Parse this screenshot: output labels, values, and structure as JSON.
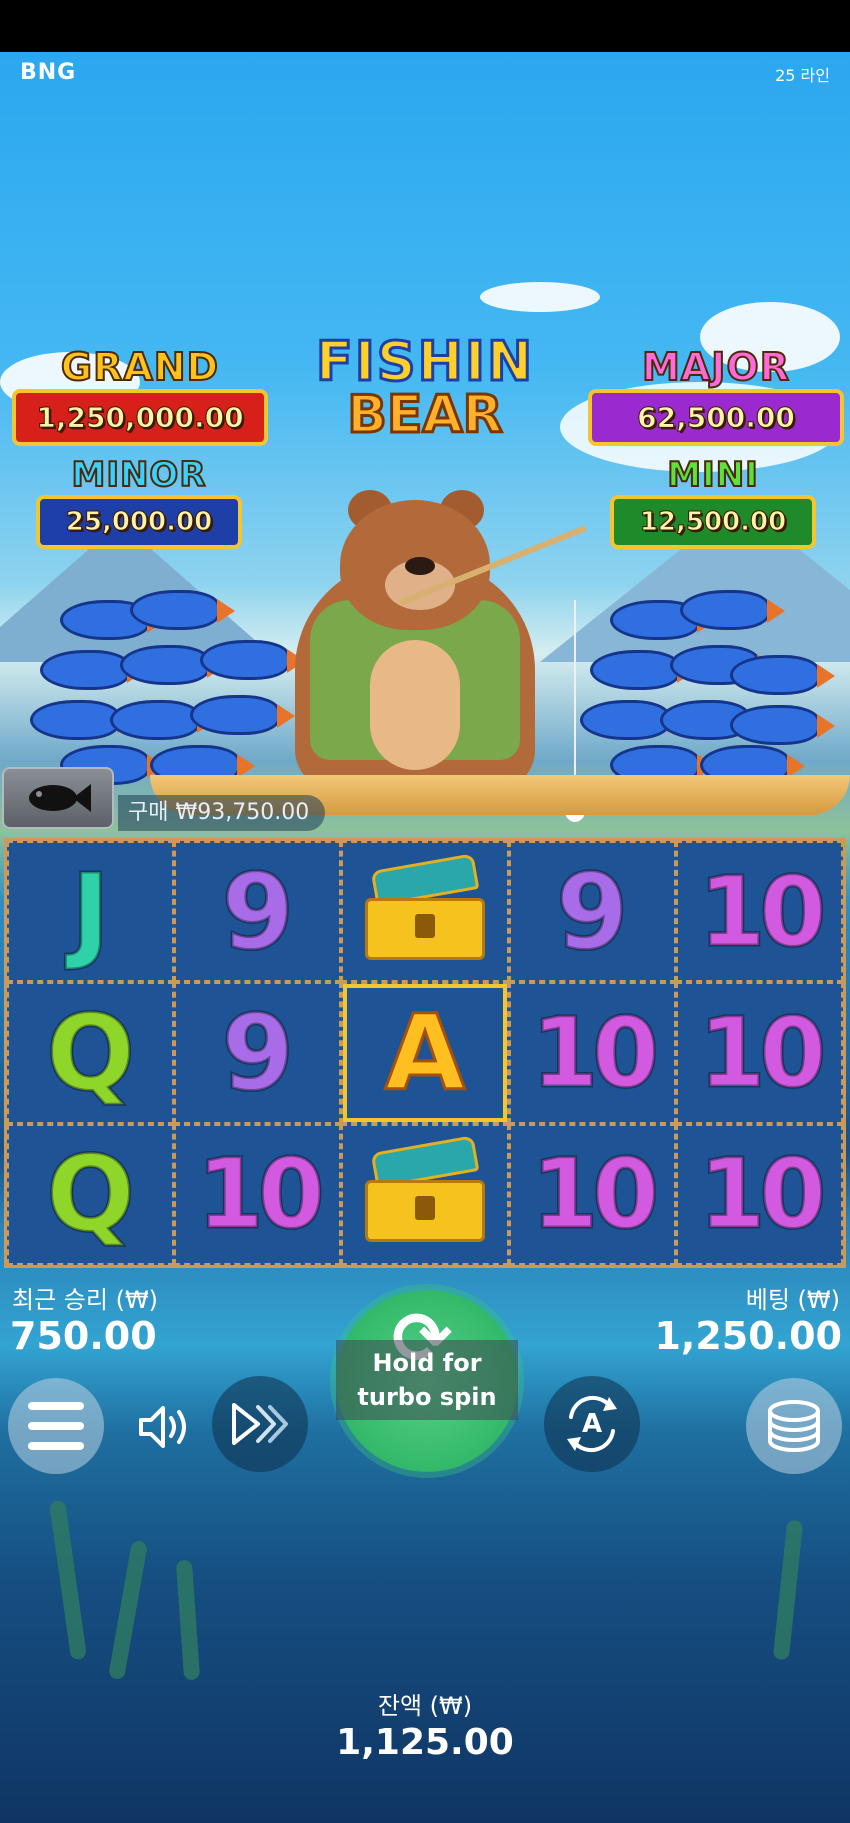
{
  "header": {
    "brand": "BNG",
    "lines": "25 라인"
  },
  "jackpots": {
    "grand": {
      "title": "GRAND",
      "value": "1,250,000.00"
    },
    "major": {
      "title": "MAJOR",
      "value": "62,500.00"
    },
    "minor": {
      "title": "MINOR",
      "value": "25,000.00"
    },
    "mini": {
      "title": "MINI",
      "value": "12,500.00"
    }
  },
  "logo": {
    "line1": "FISHIN",
    "line2": "BEAR"
  },
  "buy_feature": {
    "label": "구매 ₩93,750.00",
    "icon": "fish-icon"
  },
  "reels": [
    [
      {
        "sym": "J",
        "cls": "j"
      },
      {
        "sym": "9",
        "cls": "n9"
      },
      {
        "sym": "chest",
        "cls": "chest"
      },
      {
        "sym": "9",
        "cls": "n9"
      },
      {
        "sym": "10",
        "cls": "n10"
      }
    ],
    [
      {
        "sym": "Q",
        "cls": "q"
      },
      {
        "sym": "9",
        "cls": "n9"
      },
      {
        "sym": "A",
        "cls": "a",
        "highlight": true
      },
      {
        "sym": "10",
        "cls": "n10"
      },
      {
        "sym": "10",
        "cls": "n10"
      }
    ],
    [
      {
        "sym": "Q",
        "cls": "q"
      },
      {
        "sym": "10",
        "cls": "n10"
      },
      {
        "sym": "chest",
        "cls": "chest"
      },
      {
        "sym": "10",
        "cls": "n10"
      },
      {
        "sym": "10",
        "cls": "n10"
      }
    ]
  ],
  "last_win": {
    "label": "최근 승리 (₩)",
    "value": "750.00"
  },
  "bet": {
    "label": "베팅 (₩)",
    "value": "1,250.00"
  },
  "spin": {
    "label": "Hold for turbo spin"
  },
  "auto": {
    "label": "A"
  },
  "balance": {
    "label": "잔액 (₩)",
    "value": "1,125.00"
  },
  "colors": {
    "spin_green": "#33b86a",
    "grand_red": "#d8201a",
    "major_purple": "#9a2ad0",
    "minor_blue": "#1f3fa8",
    "mini_green": "#1f8a2a"
  }
}
